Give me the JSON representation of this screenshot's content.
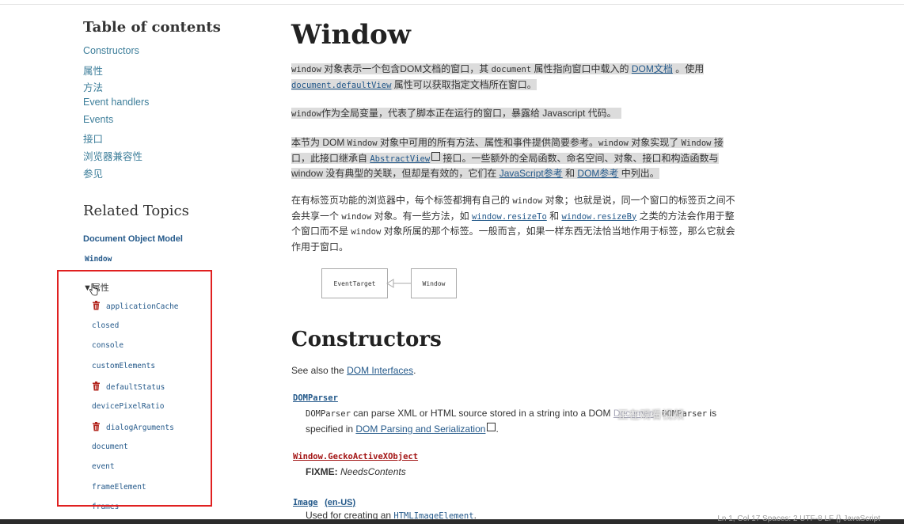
{
  "toc": {
    "title": "Table of contents",
    "items": [
      "Constructors",
      "属性",
      "方法",
      "Event handlers",
      "Events",
      "接口",
      "浏览器兼容性",
      "参见"
    ]
  },
  "related": {
    "title": "Related Topics",
    "dom_link": "Document Object Model",
    "window_link": "Window",
    "properties_toggle": "▼属性",
    "properties": [
      {
        "name": "applicationCache",
        "deprecated": true
      },
      {
        "name": "closed",
        "deprecated": false
      },
      {
        "name": "console",
        "deprecated": false
      },
      {
        "name": "customElements",
        "deprecated": false
      },
      {
        "name": "defaultStatus",
        "deprecated": true
      },
      {
        "name": "devicePixelRatio",
        "deprecated": false
      },
      {
        "name": "dialogArguments",
        "deprecated": true
      },
      {
        "name": "document",
        "deprecated": false
      },
      {
        "name": "event",
        "deprecated": false
      },
      {
        "name": "frameElement",
        "deprecated": false
      },
      {
        "name": "frames",
        "deprecated": false
      }
    ]
  },
  "main": {
    "title": "Window",
    "p1": {
      "code1": "window",
      "t1": " 对象表示一个包含DOM文档的窗口，其 ",
      "code2": "document",
      "t2": " 属性指向窗口中载入的 ",
      "link1": "DOM文档",
      "t3": " 。使用 ",
      "link2": "document.defaultView",
      "t4": " 属性可以获取指定文档所在窗口。"
    },
    "p2": {
      "code1": "window",
      "t1": "作为全局变量，代表了脚本正在运行的窗口，暴露给 Javascript 代码。"
    },
    "p3": {
      "t1": "本节为 DOM ",
      "code1": "Window",
      "t2": " 对象中可用的所有方法、属性和事件提供简要参考。",
      "code2": "window",
      "t3": " 对象实现了 ",
      "code3": "Window",
      "t4": " 接口，此接口继承自 ",
      "link1": "AbstractView",
      "t5": " 接口。一些额外的全局函数、命名空间、对象、接口和构造函数与 window 没有典型的关联，但却是有效的，它们在 ",
      "link2": "JavaScript参考",
      "t6": " 和 ",
      "link3": "DOM参考",
      "t7": " 中列出。"
    },
    "p4": {
      "t1": "在有标签页功能的浏览器中，每个标签都拥有自己的 ",
      "code1": "window",
      "t2": " 对象；也就是说，同一个窗口的标签页之间不会共享一个 ",
      "code2": "window",
      "t3": " 对象。有一些方法，如 ",
      "link1": "window.resizeTo",
      "t4": " 和 ",
      "link2": "window.resizeBy",
      "t5": " 之类的方法会作用于整个窗口而不是 ",
      "code3": "window",
      "t6": " 对象所属的那个标签。一般而言，如果一样东西无法恰当地作用于标签，那么它就会作用于窗口。"
    },
    "diagram": {
      "left": "EventTarget",
      "right": "Window"
    },
    "constructors": {
      "title": "Constructors",
      "see_also_prefix": "See also the ",
      "see_also_link": "DOM Interfaces",
      "see_also_suffix": ".",
      "items": [
        {
          "name": "DOMParser",
          "color": "#24598a",
          "desc_code": "DOMParser",
          "desc_t1": " can parse XML or HTML source stored in a string into a DOM ",
          "desc_link_partial": "Document",
          "desc_t2": ". ",
          "desc_code2": "DOMParser",
          "desc_t3": " is",
          "desc_line2_t": "specified in ",
          "desc_line2_link": "DOM Parsing and Serialization",
          "desc_line2_end": "."
        },
        {
          "name": "Window.GeckoActiveXObject",
          "color": "#a31515",
          "fixme_label": "FIXME:",
          "fixme_text": " NeedsContents"
        },
        {
          "name": "Image",
          "name_suffix": "(en-US)",
          "color": "#24598a",
          "desc_t1": "Used for creating an ",
          "desc_link": "HTMLImageElement",
          "desc_end": "."
        }
      ]
    },
    "overlay_text": "正在观看视频"
  },
  "statusbar": "Ln 1, Col 17   Spaces: 2   UTF-8   LF   {} JavaScript"
}
